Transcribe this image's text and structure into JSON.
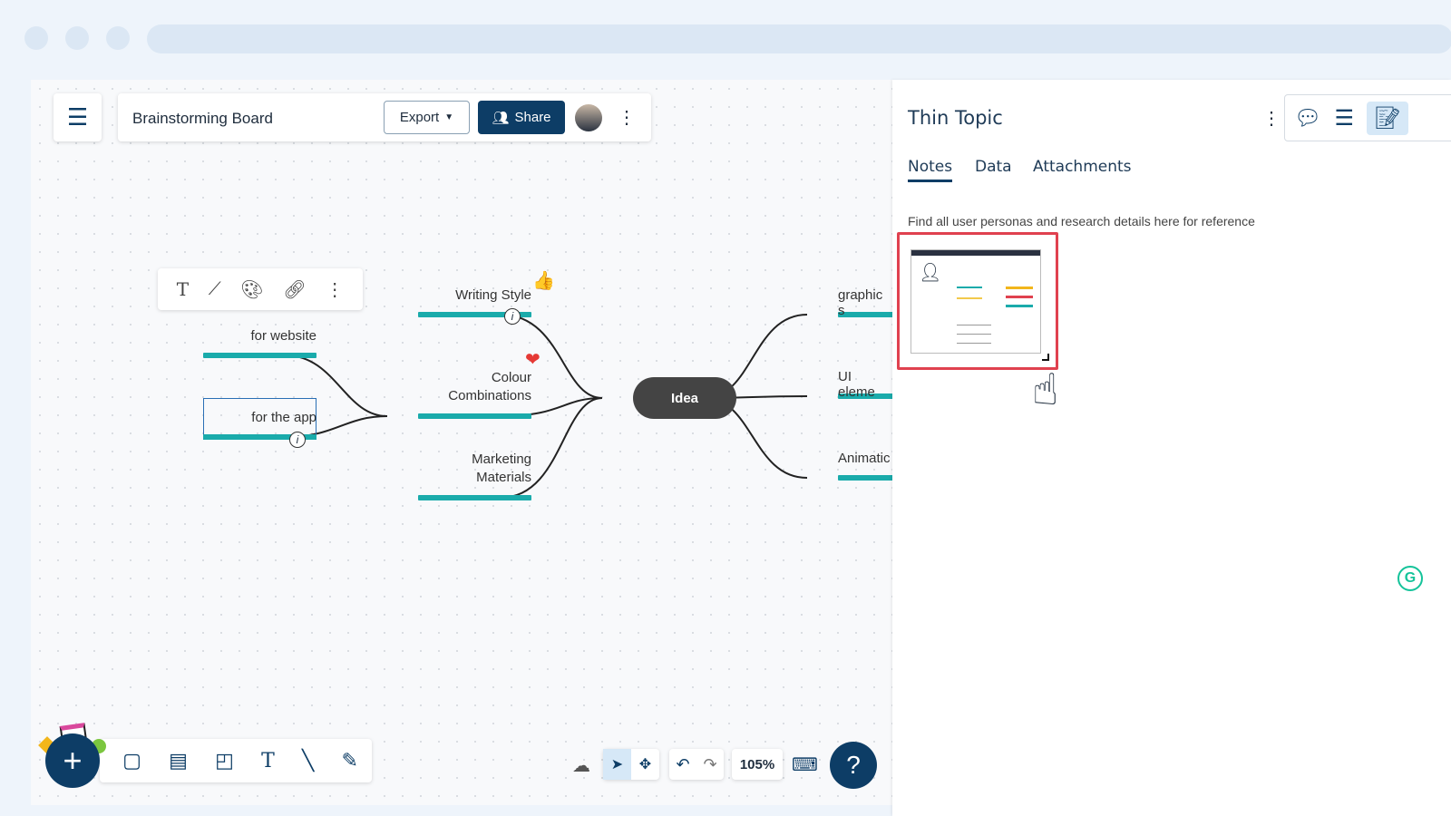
{
  "header": {
    "title": "Brainstorming Board",
    "export_label": "Export",
    "share_label": "Share"
  },
  "mindmap": {
    "central": "Idea",
    "left": [
      {
        "label": "Writing Style"
      },
      {
        "label": "Colour\nCombinations"
      },
      {
        "label": "Marketing\nMaterials"
      }
    ],
    "sub": [
      {
        "label": "for website"
      },
      {
        "label": "for the app"
      }
    ],
    "right": [
      {
        "label": "graphic s"
      },
      {
        "label": "UI eleme"
      },
      {
        "label": "Animatic"
      }
    ],
    "colors": {
      "branch": "#1aabab",
      "central": "#444444"
    }
  },
  "toolbar": {
    "zoom": "105%",
    "help": "?"
  },
  "panel": {
    "title": "Thin Topic",
    "tabs": [
      {
        "label": "Notes",
        "active": true
      },
      {
        "label": "Data"
      },
      {
        "label": "Attachments"
      }
    ],
    "note_text": "Find all user personas and research details here for reference"
  },
  "colors": {
    "primary": "#0d3d66",
    "accent": "#1aabab",
    "highlight": "#e0414f"
  }
}
